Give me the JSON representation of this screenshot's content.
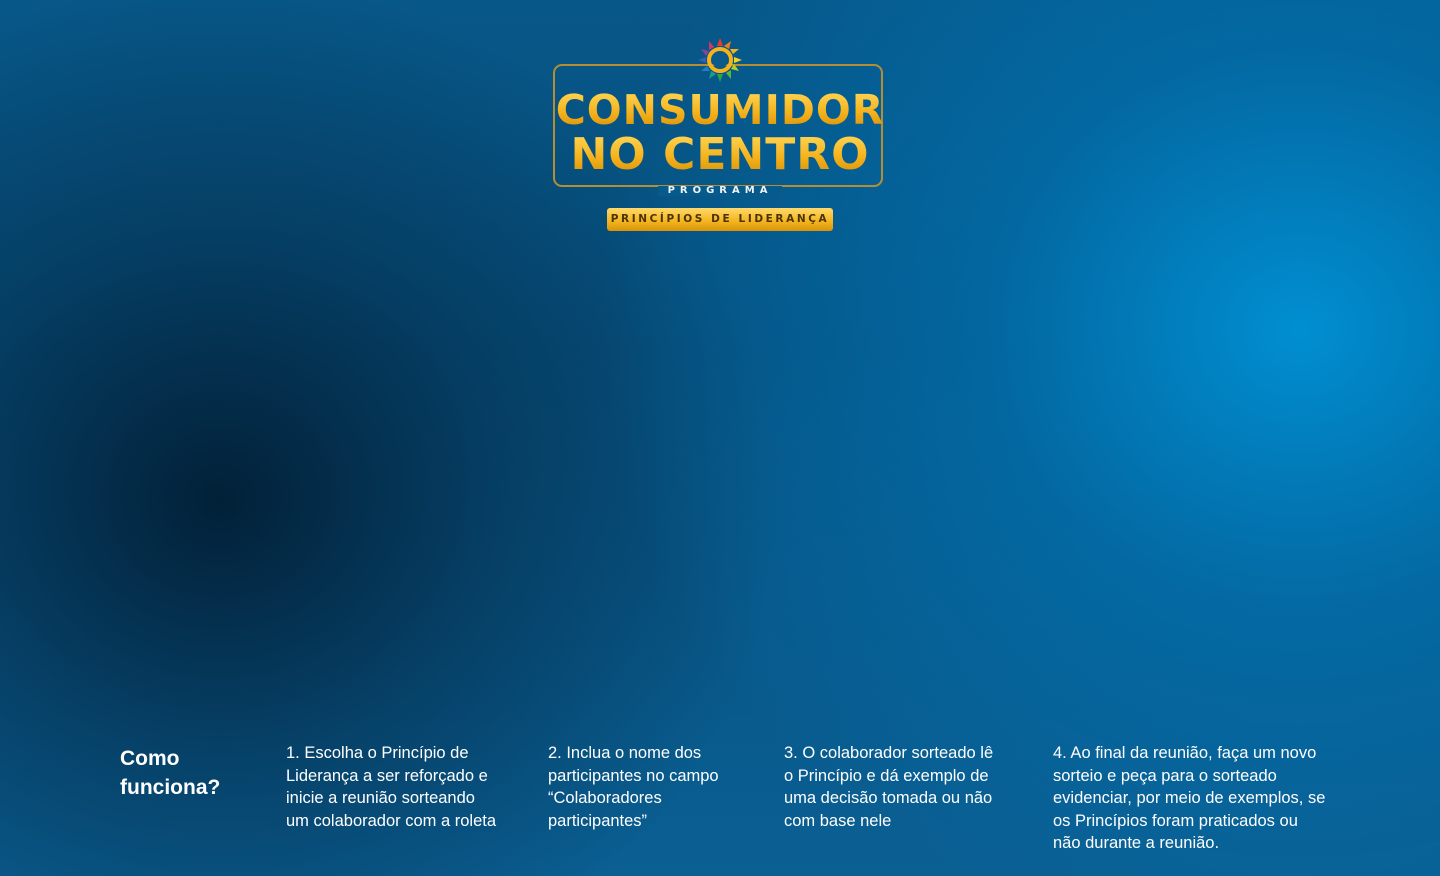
{
  "logo": {
    "line1": "CONSUMIDOR",
    "line2": "NO CENTRO",
    "programa": "PROGRAMA",
    "badge": "PRINCÍPIOS DE LIDERANÇA",
    "icon": "sun-icon"
  },
  "colors": {
    "gold": "#f2b51c",
    "gold_border": "#b58d35",
    "background_blue": "#075788",
    "highlight_blue": "#0092d6",
    "text": "#ffffff"
  },
  "instructions": {
    "heading_line1": "Como",
    "heading_line2": "funciona?",
    "steps": [
      {
        "lines": [
          "1. Escolha o Princípio de",
          "Liderança a ser reforçado e",
          "inicie a reunião sorteando",
          "um colaborador com a roleta"
        ]
      },
      {
        "lines": [
          "2. Inclua o nome dos",
          "participantes no campo",
          "“Colaboradores",
          "participantes”"
        ]
      },
      {
        "lines": [
          "3. O colaborador sorteado lê",
          "o Princípio e dá exemplo de",
          "uma decisão tomada ou não",
          "com base nele"
        ]
      },
      {
        "lines": [
          "4. Ao final da reunião, faça um novo",
          "sorteio e peça para o sorteado",
          "evidenciar, por meio de exemplos, se",
          "os Princípios foram praticados ou",
          "não durante a reunião."
        ]
      }
    ]
  }
}
